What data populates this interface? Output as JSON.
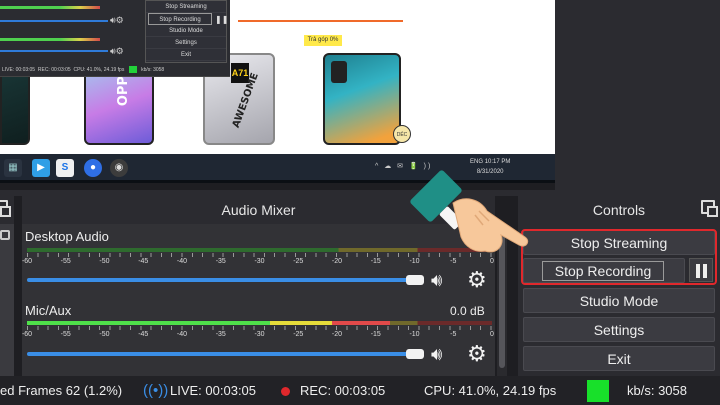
{
  "preview": {
    "promo_text": "Trả góp 0%",
    "phone2_text": "OPPO",
    "phone3_model": "A71",
    "phone3_text": "AWESOME",
    "badge_text": "DẺC"
  },
  "mini_obs": {
    "menu": [
      "Stop Streaming",
      "Stop Recording",
      "Studio Mode",
      "Settings",
      "Exit"
    ],
    "status": {
      "live": "LIVE: 00:03:05",
      "rec": "REC: 00:03:05",
      "cpu": "CPU: 41.0%, 24.19 fps",
      "kbs": "kb/s: 3058"
    }
  },
  "taskbar": {
    "lang": "ENG",
    "time": "10:17 PM",
    "date": "8/31/2020"
  },
  "audio_mixer": {
    "title": "Audio Mixer",
    "channels": [
      {
        "name": "Desktop Audio",
        "db": "",
        "level": 0.0,
        "volume": 0.86
      },
      {
        "name": "Mic/Aux",
        "db": "0.0 dB",
        "level": 0.78,
        "volume": 0.86
      }
    ],
    "scale": [
      "-60",
      "-55",
      "-50",
      "-45",
      "-40",
      "-35",
      "-30",
      "-25",
      "-20",
      "-15",
      "-10",
      "-5",
      "0"
    ]
  },
  "controls": {
    "title": "Controls",
    "stop_streaming": "Stop Streaming",
    "stop_recording": "Stop Recording",
    "studio_mode": "Studio Mode",
    "settings": "Settings",
    "exit": "Exit"
  },
  "status_bar": {
    "dropped": "ed Frames 62 (1.2%)",
    "live": "LIVE: 00:03:05",
    "rec": "REC: 00:03:05",
    "cpu": "CPU: 41.0%, 24.19 fps",
    "kbs": "kb/s: 3058",
    "health_color": "#18e02a"
  },
  "colors": {
    "accent": "#3a8ee6",
    "highlight": "#e0282c"
  }
}
